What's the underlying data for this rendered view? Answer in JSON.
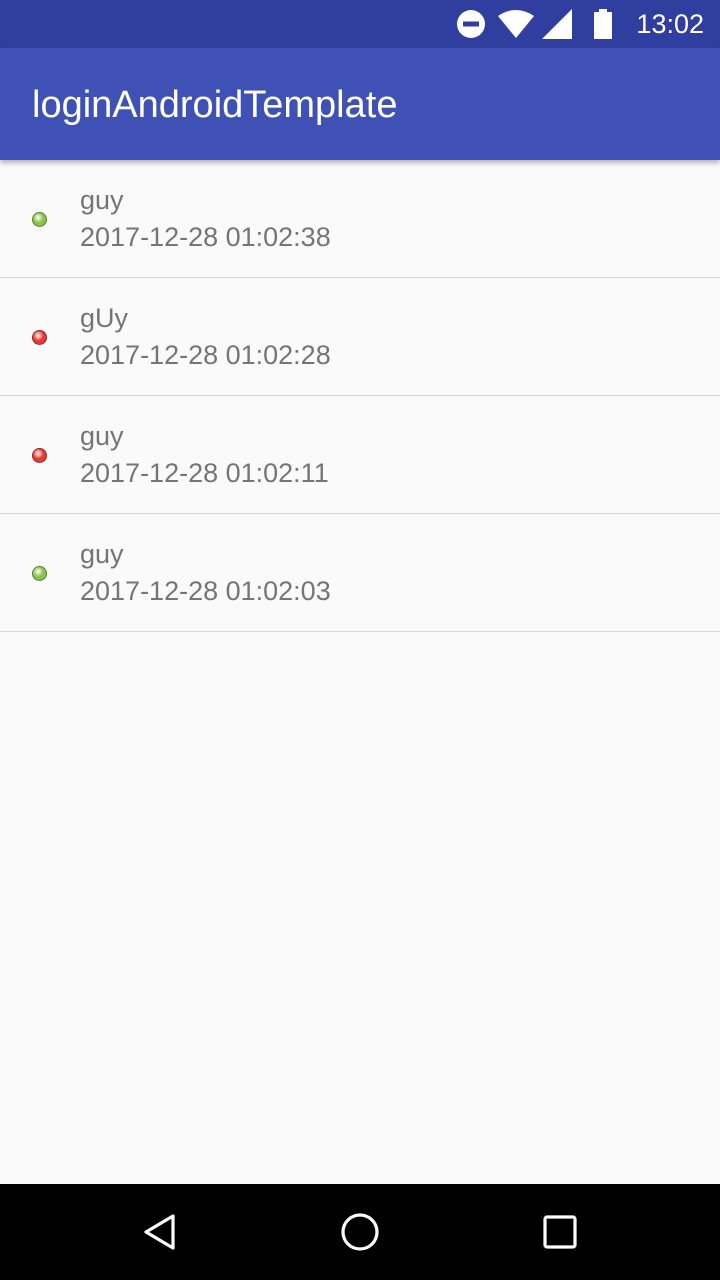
{
  "status_bar": {
    "time": "13:02",
    "icons": [
      "do-not-disturb-icon",
      "wifi-icon",
      "signal-icon",
      "battery-icon"
    ],
    "background": "#303f9f"
  },
  "app_bar": {
    "title": "loginAndroidTemplate",
    "background": "#3f51b5"
  },
  "list": {
    "items": [
      {
        "name": "guy",
        "timestamp": "2017-12-28 01:02:38",
        "status": "success",
        "dot_color": "#8bc34a"
      },
      {
        "name": "gUy",
        "timestamp": "2017-12-28 01:02:28",
        "status": "failure",
        "dot_color": "#e53935"
      },
      {
        "name": "guy",
        "timestamp": "2017-12-28 01:02:11",
        "status": "failure",
        "dot_color": "#e53935"
      },
      {
        "name": "guy",
        "timestamp": "2017-12-28 01:02:03",
        "status": "success",
        "dot_color": "#8bc34a"
      }
    ]
  },
  "nav_bar": {
    "buttons": [
      "back-icon",
      "home-icon",
      "recents-icon"
    ]
  }
}
